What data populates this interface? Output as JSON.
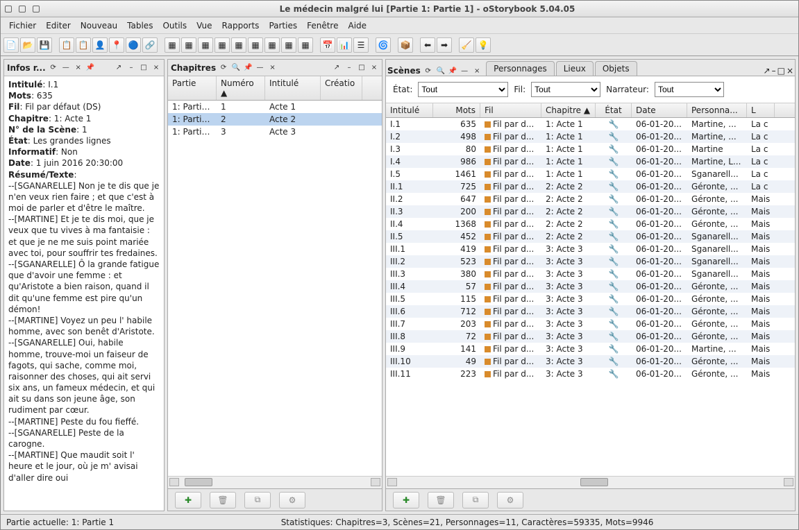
{
  "window": {
    "title": "Le médecin malgré lui [Partie 1: Partie 1] - oStorybook 5.04.05"
  },
  "menus": [
    "Fichier",
    "Editer",
    "Nouveau",
    "Tables",
    "Outils",
    "Vue",
    "Rapports",
    "Parties",
    "Fenêtre",
    "Aide"
  ],
  "info_panel": {
    "title": "Infos r...",
    "intitule_label": "Intitulé",
    "intitule": "I.1",
    "mots_label": "Mots",
    "mots": "635",
    "fil_label": "Fil",
    "fil": "Fil par défaut (DS)",
    "chapitre_label": "Chapitre",
    "chapitre": "1: Acte 1",
    "nscene_label": "N° de la Scène",
    "nscene": "1",
    "etat_label": "État",
    "etat": "Les grandes lignes",
    "informatif_label": "Informatif",
    "informatif": "Non",
    "date_label": "Date",
    "date": "1 juin 2016 20:30:00",
    "resume_label": "Résumé/Texte",
    "resume_lines": [
      "--[SGANARELLE] Non je te dis que je n'en veux rien faire ; et que c'est à moi de parler et d'être le maître.",
      "--[MARTINE] Et je te dis moi, que je veux que tu vives à ma fantaisie : et que je ne me suis point mariée avec toi, pour souffrir tes fredaines.",
      "--[SGANARELLE] Ô la grande fatigue que d'avoir une femme : et qu'Aristote a bien raison, quand il dit qu'une femme est pire qu'un démon!",
      "--[MARTINE] Voyez un peu l' habile homme, avec son benêt d'Aristote.",
      "--[SGANARELLE] Oui, habile homme, trouve-moi un faiseur de fagots, qui sache, comme moi, raisonner des choses, qui ait servi six ans, un fameux médecin, et qui ait su dans son jeune âge, son rudiment par cœur.",
      "--[MARTINE] Peste du fou fieffé.",
      "--[SGANARELLE] Peste de la carogne.",
      "--[MARTINE] Que maudit soit l' heure et le jour, où je m' avisai d'aller dire oui"
    ]
  },
  "chapitres": {
    "title": "Chapitres",
    "headers": [
      "Partie",
      "Numéro ▲",
      "Intitulé",
      "Créatio"
    ],
    "rows": [
      {
        "partie": "1: Partie 1",
        "num": "1",
        "intitule": "Acte 1"
      },
      {
        "partie": "1: Partie 1",
        "num": "2",
        "intitule": "Acte 2"
      },
      {
        "partie": "1: Partie 1",
        "num": "3",
        "intitule": "Acte 3"
      }
    ],
    "selected": 1
  },
  "tabs": {
    "scenes": "Scènes",
    "personnages": "Personnages",
    "lieux": "Lieux",
    "objets": "Objets"
  },
  "filters": {
    "etat_label": "État:",
    "etat_value": "Tout",
    "fil_label": "Fil:",
    "fil_value": "Tout",
    "narr_label": "Narrateur:",
    "narr_value": "Tout"
  },
  "scenes": {
    "headers": [
      "Intitulé",
      "Mots",
      "Fil",
      "Chapitre ▲",
      "État",
      "Date",
      "Personna...",
      "L"
    ],
    "rows": [
      {
        "i": "I.1",
        "m": "635",
        "f": "Fil par d...",
        "c": "1: Acte 1",
        "d": "06-01-20...",
        "p": "Martine, ...",
        "l": "La c"
      },
      {
        "i": "I.2",
        "m": "498",
        "f": "Fil par d...",
        "c": "1: Acte 1",
        "d": "06-01-20...",
        "p": "Martine, ...",
        "l": "La c"
      },
      {
        "i": "I.3",
        "m": "80",
        "f": "Fil par d...",
        "c": "1: Acte 1",
        "d": "06-01-20...",
        "p": "Martine",
        "l": "La c"
      },
      {
        "i": "I.4",
        "m": "986",
        "f": "Fil par d...",
        "c": "1: Acte 1",
        "d": "06-01-20...",
        "p": "Martine, L...",
        "l": "La c"
      },
      {
        "i": "I.5",
        "m": "1461",
        "f": "Fil par d...",
        "c": "1: Acte 1",
        "d": "06-01-20...",
        "p": "Sganarell...",
        "l": "La c"
      },
      {
        "i": "II.1",
        "m": "725",
        "f": "Fil par d...",
        "c": "2: Acte 2",
        "d": "06-01-20...",
        "p": "Géronte, ...",
        "l": "La c"
      },
      {
        "i": "II.2",
        "m": "647",
        "f": "Fil par d...",
        "c": "2: Acte 2",
        "d": "06-01-20...",
        "p": "Géronte, ...",
        "l": "Mais"
      },
      {
        "i": "II.3",
        "m": "200",
        "f": "Fil par d...",
        "c": "2: Acte 2",
        "d": "06-01-20...",
        "p": "Géronte, ...",
        "l": "Mais"
      },
      {
        "i": "II.4",
        "m": "1368",
        "f": "Fil par d...",
        "c": "2: Acte 2",
        "d": "06-01-20...",
        "p": "Géronte, ...",
        "l": "Mais"
      },
      {
        "i": "II.5",
        "m": "452",
        "f": "Fil par d...",
        "c": "2: Acte 2",
        "d": "06-01-20...",
        "p": "Sganarell...",
        "l": "Mais"
      },
      {
        "i": "III.1",
        "m": "419",
        "f": "Fil par d...",
        "c": "3: Acte 3",
        "d": "06-01-20...",
        "p": "Sganarell...",
        "l": "Mais"
      },
      {
        "i": "III.2",
        "m": "523",
        "f": "Fil par d...",
        "c": "3: Acte 3",
        "d": "06-01-20...",
        "p": "Sganarell...",
        "l": "Mais"
      },
      {
        "i": "III.3",
        "m": "380",
        "f": "Fil par d...",
        "c": "3: Acte 3",
        "d": "06-01-20...",
        "p": "Sganarell...",
        "l": "Mais"
      },
      {
        "i": "III.4",
        "m": "57",
        "f": "Fil par d...",
        "c": "3: Acte 3",
        "d": "06-01-20...",
        "p": "Géronte, ...",
        "l": "Mais"
      },
      {
        "i": "III.5",
        "m": "115",
        "f": "Fil par d...",
        "c": "3: Acte 3",
        "d": "06-01-20...",
        "p": "Géronte, ...",
        "l": "Mais"
      },
      {
        "i": "III.6",
        "m": "712",
        "f": "Fil par d...",
        "c": "3: Acte 3",
        "d": "06-01-20...",
        "p": "Géronte, ...",
        "l": "Mais"
      },
      {
        "i": "III.7",
        "m": "203",
        "f": "Fil par d...",
        "c": "3: Acte 3",
        "d": "06-01-20...",
        "p": "Géronte, ...",
        "l": "Mais"
      },
      {
        "i": "III.8",
        "m": "72",
        "f": "Fil par d...",
        "c": "3: Acte 3",
        "d": "06-01-20...",
        "p": "Géronte, ...",
        "l": "Mais"
      },
      {
        "i": "III.9",
        "m": "141",
        "f": "Fil par d...",
        "c": "3: Acte 3",
        "d": "06-01-20...",
        "p": "Martine, ...",
        "l": "Mais"
      },
      {
        "i": "III.10",
        "m": "49",
        "f": "Fil par d...",
        "c": "3: Acte 3",
        "d": "06-01-20...",
        "p": "Géronte, ...",
        "l": "Mais"
      },
      {
        "i": "III.11",
        "m": "223",
        "f": "Fil par d...",
        "c": "3: Acte 3",
        "d": "06-01-20...",
        "p": "Géronte, ...",
        "l": "Mais"
      }
    ]
  },
  "status": {
    "left": "Partie actuelle: 1: Partie 1",
    "center": "Statistiques: Chapitres=3,  Scènes=21,  Personnages=11,  Caractères=59335,  Mots=9946"
  }
}
